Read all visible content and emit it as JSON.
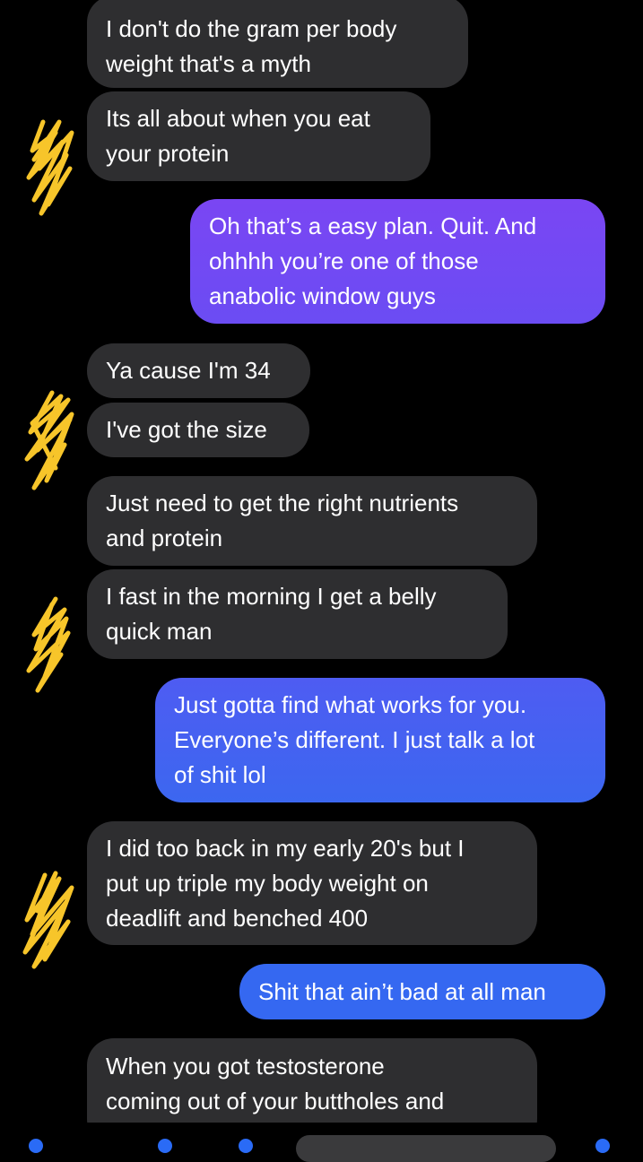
{
  "messages": [
    {
      "id": "m1",
      "side": "in",
      "lines": [
        "I don't do the gram per body",
        "weight that's a myth"
      ]
    },
    {
      "id": "m2",
      "side": "in",
      "lines": [
        "Its all about when you eat",
        "your protein"
      ]
    },
    {
      "id": "m3",
      "side": "out",
      "lines": [
        "Oh that’s a easy plan. Quit. And",
        "ohhhh you’re one of those",
        "anabolic window guys"
      ]
    },
    {
      "id": "m4",
      "side": "in",
      "lines": [
        "Ya cause I'm 34"
      ]
    },
    {
      "id": "m5",
      "side": "in",
      "lines": [
        "I've got the size"
      ]
    },
    {
      "id": "m6",
      "side": "in",
      "lines": [
        "Just need to get the right nutrients",
        "and protein"
      ]
    },
    {
      "id": "m7",
      "side": "in",
      "lines": [
        "I fast in the morning I get a belly",
        "quick man"
      ]
    },
    {
      "id": "m8",
      "side": "out",
      "lines": [
        "Just gotta find what works for you.",
        "Everyone’s different. I just talk a lot",
        "of shit lol"
      ]
    },
    {
      "id": "m9",
      "side": "in",
      "lines": [
        "I did too back in my early 20's but I",
        "put up triple my body weight on",
        "deadlift and benched 400"
      ]
    },
    {
      "id": "m10",
      "side": "out",
      "lines": [
        "Shit that ain’t bad at all man"
      ]
    },
    {
      "id": "m11",
      "side": "in",
      "lines": [
        "When you got testosterone",
        "coming out of your buttholes and"
      ]
    }
  ],
  "colors": {
    "incoming_bubble": "#2e2e30",
    "outgoing_purple": "#7a46f3",
    "outgoing_blue": "#3c67f0",
    "scribble": "#f7c52a"
  }
}
